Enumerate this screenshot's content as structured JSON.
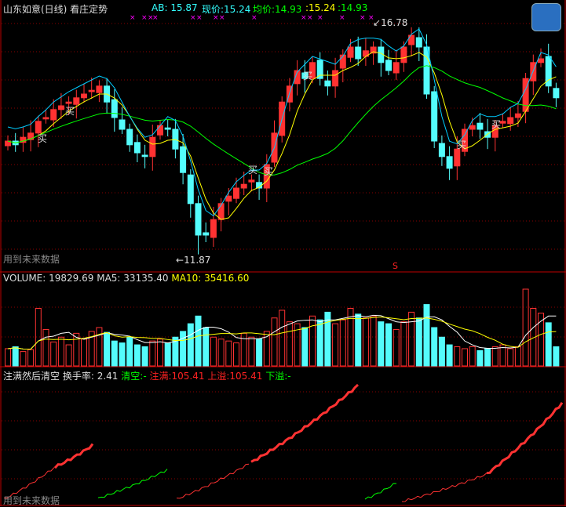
{
  "header": {
    "title": "山东如意(日线) 看庄定势",
    "ab_label": "AB:",
    "ab_value": "15.87",
    "price_label": "现价:",
    "price_value": "15.24",
    "avg_label": "均价:",
    "avg_value": "14.93",
    "sep1": ":",
    "mid_value": "15.24",
    "sep2": ":",
    "last_value": "14.93"
  },
  "main": {
    "high_label": "16.78",
    "low_label": "11.87",
    "buy_label": "买",
    "watermark": "用到未来数据",
    "s_marker": "S"
  },
  "volume_panel": {
    "volume_label": "VOLUME:",
    "volume_value": "19829.69",
    "ma5_label": "MA5:",
    "ma5_value": "33135.40",
    "ma10_label": "MA10:",
    "ma10_value": "35416.60"
  },
  "indicator_panel": {
    "name": "注满然后清空",
    "turnover_label": "换手率:",
    "turnover_value": "2.41",
    "clear_label": "清空:",
    "clear_value": "-",
    "fill_label": "注满:",
    "fill_value": "105.41",
    "overflow_label": "上溢:",
    "overflow_value": "105.41",
    "underflow_label": "下溢:",
    "underflow_value": "-",
    "watermark": "用到未来数据"
  },
  "colors": {
    "up": "#ff3232",
    "down": "#54fcfc",
    "ma_fast": "#ffff00",
    "ma_slow": "#00ff00",
    "line3": "#00ccff",
    "frame": "#c00000"
  },
  "chart_data": {
    "type": "candlestick",
    "price_range": [
      11.87,
      16.78
    ],
    "close": [
      14.28,
      14.2,
      14.36,
      14.45,
      14.7,
      14.78,
      14.95,
      15.03,
      15.11,
      15.2,
      15.28,
      15.36,
      15.45,
      15.11,
      14.78,
      14.53,
      14.2,
      14.03,
      13.95,
      14.36,
      14.61,
      14.53,
      14.11,
      13.61,
      12.95,
      12.28,
      12.28,
      12.61,
      12.95,
      13.11,
      13.28,
      13.36,
      13.45,
      13.28,
      13.78,
      14.45,
      15.11,
      15.45,
      15.78,
      15.61,
      15.95,
      15.61,
      15.45,
      15.78,
      16.11,
      16.28,
      16.03,
      16.2,
      16.28,
      15.95,
      15.78,
      15.95,
      16.28,
      16.53,
      16.28,
      15.28,
      14.28,
      13.95,
      13.7,
      14.11,
      14.53,
      14.61,
      14.53,
      14.36,
      14.61,
      14.7,
      14.78,
      14.86,
      15.61,
      15.95,
      16.03,
      15.45,
      15.2
    ],
    "volume": [
      18000,
      20000,
      15000,
      17000,
      60000,
      38000,
      25000,
      30000,
      22000,
      34000,
      28000,
      36000,
      40000,
      35000,
      26000,
      24000,
      30000,
      22000,
      20000,
      26000,
      28000,
      24000,
      30000,
      36000,
      44000,
      52000,
      40000,
      30000,
      28000,
      26000,
      24000,
      34000,
      30000,
      28000,
      36000,
      50000,
      58000,
      46000,
      44000,
      40000,
      52000,
      48000,
      56000,
      44000,
      48000,
      60000,
      54000,
      50000,
      52000,
      46000,
      44000,
      38000,
      46000,
      56000,
      50000,
      64000,
      40000,
      30000,
      22000,
      20000,
      18000,
      20000,
      16000,
      18000,
      20000,
      22000,
      18000,
      20000,
      80000,
      60000,
      55000,
      45000,
      20000
    ]
  }
}
